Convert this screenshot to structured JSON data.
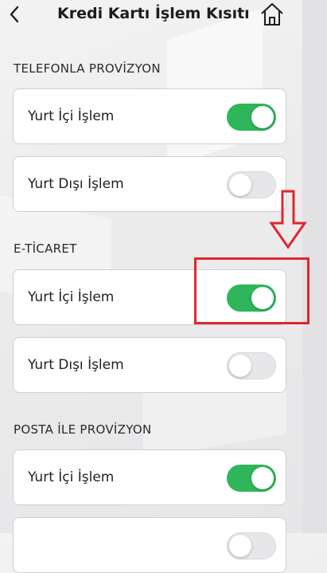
{
  "header": {
    "title": "Kredi Kartı İşlem Kısıtı",
    "back_icon": "chevron-left-icon",
    "home_icon": "home-icon"
  },
  "sections": [
    {
      "title": "TELEFONLA PROVİZYON",
      "rows": [
        {
          "label": "Yurt İçi İşlem",
          "enabled": true
        },
        {
          "label": "Yurt Dışı İşlem",
          "enabled": false
        }
      ]
    },
    {
      "title": "E-TİCARET",
      "rows": [
        {
          "label": "Yurt İçi İşlem",
          "enabled": true
        },
        {
          "label": "Yurt Dışı İşlem",
          "enabled": false
        }
      ]
    },
    {
      "title": "POSTA İLE PROVİZYON",
      "rows": [
        {
          "label": "Yurt İçi İşlem",
          "enabled": true
        },
        {
          "label": "",
          "enabled": false
        }
      ]
    }
  ],
  "colors": {
    "toggle_on": "#2fb55a",
    "toggle_off": "#e7e7e9",
    "annotation": "#e0262d"
  }
}
